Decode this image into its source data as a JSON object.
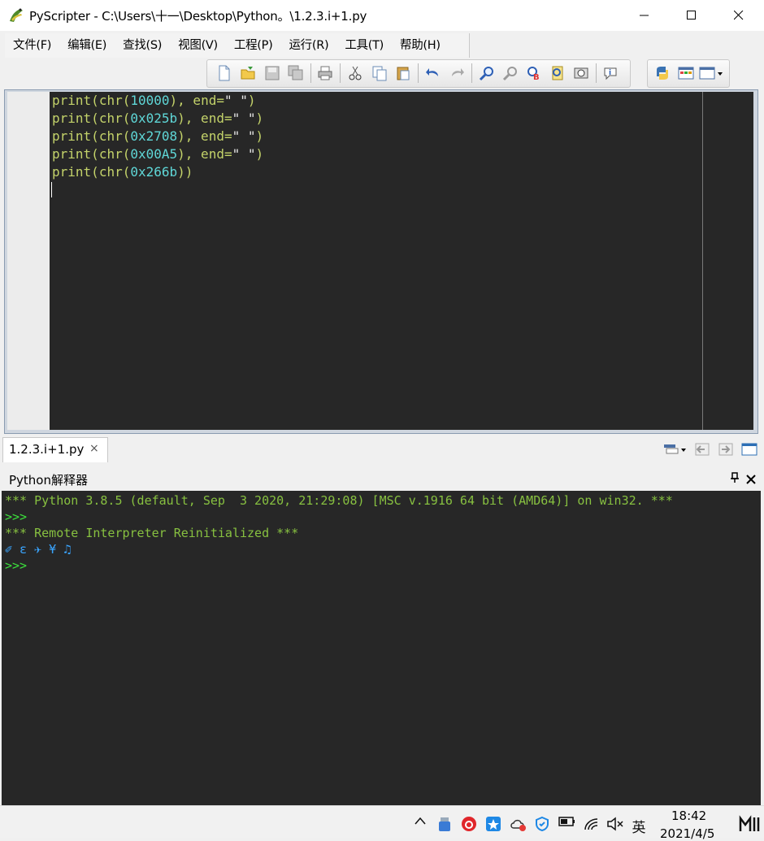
{
  "window": {
    "title": "PyScripter - C:\\Users\\十一\\Desktop\\Python。\\1.2.3.i+1.py"
  },
  "menu": [
    "文件(F)",
    "编辑(E)",
    "查找(S)",
    "视图(V)",
    "工程(P)",
    "运行(R)",
    "工具(T)",
    "帮助(H)"
  ],
  "editor": {
    "lines": [
      {
        "kw": "print",
        "a": "(",
        "fn": "chr",
        "b": "(",
        "num": "10000",
        "c": "), end=",
        "str": "\" \"",
        "d": ")"
      },
      {
        "kw": "print",
        "a": "(",
        "fn": "chr",
        "b": "(",
        "num": "0x025b",
        "c": "), end=",
        "str": "\" \"",
        "d": ")"
      },
      {
        "kw": "print",
        "a": "(",
        "fn": "chr",
        "b": "(",
        "num": "0x2708",
        "c": "), end=",
        "str": "\" \"",
        "d": ")"
      },
      {
        "kw": "print",
        "a": "(",
        "fn": "chr",
        "b": "(",
        "num": "0x00A5",
        "c": "), end=",
        "str": "\" \"",
        "d": ")"
      },
      {
        "kw": "print",
        "a": "(",
        "fn": "chr",
        "b": "(",
        "num": "0x266b",
        "c": "))",
        "str": "",
        "d": ""
      }
    ]
  },
  "tab": {
    "label": "1.2.3.i+1.py",
    "close": "×"
  },
  "interpreter": {
    "title": "Python解释器",
    "lines": {
      "banner": "*** Python 3.8.5 (default, Sep  3 2020, 21:29:08) [MSC v.1916 64 bit (AMD64)] on win32. ***",
      "prompt1": ">>>",
      "reinit": "*** Remote Interpreter Reinitialized ***",
      "output": "✐ ɛ ✈ ¥ ♫",
      "prompt2": ">>>"
    }
  },
  "taskbar": {
    "ime": "英",
    "time": "18:42",
    "date": "2021/4/5"
  }
}
